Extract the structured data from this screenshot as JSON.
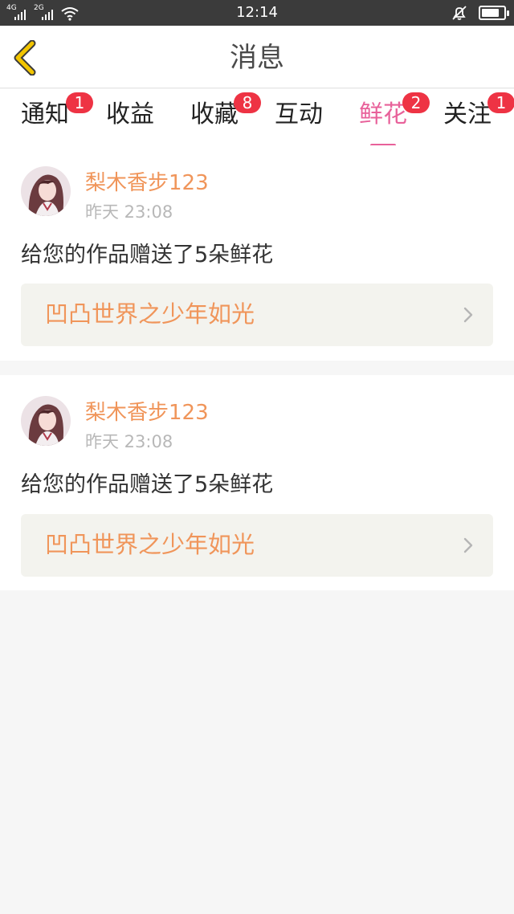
{
  "status_bar": {
    "time": "12:14",
    "signal1_tag": "4G",
    "signal2_tag": "2G",
    "icons": [
      "signal-4g-icon",
      "signal-2g-icon",
      "wifi-icon",
      "silent-bell-icon",
      "battery-icon"
    ]
  },
  "header": {
    "title": "消息",
    "back_icon": "chevron-left-icon",
    "accent": "#f2c500"
  },
  "tabs": [
    {
      "label": "通知",
      "badge": "1"
    },
    {
      "label": "收益",
      "badge": ""
    },
    {
      "label": "收藏",
      "badge": "8"
    },
    {
      "label": "互动",
      "badge": ""
    },
    {
      "label": "鲜花",
      "badge": "2",
      "active": true
    },
    {
      "label": "关注",
      "badge": "1"
    }
  ],
  "colors": {
    "active_tab": "#e8619a",
    "badge": "#ee3344",
    "username": "#f0955a",
    "link": "#f0955a"
  },
  "messages": [
    {
      "username": "梨木香步123",
      "time": "昨天 23:08",
      "text": "给您的作品赠送了5朵鲜花",
      "work_title": "凹凸世界之少年如光"
    },
    {
      "username": "梨木香步123",
      "time": "昨天 23:08",
      "text": "给您的作品赠送了5朵鲜花",
      "work_title": "凹凸世界之少年如光"
    }
  ]
}
